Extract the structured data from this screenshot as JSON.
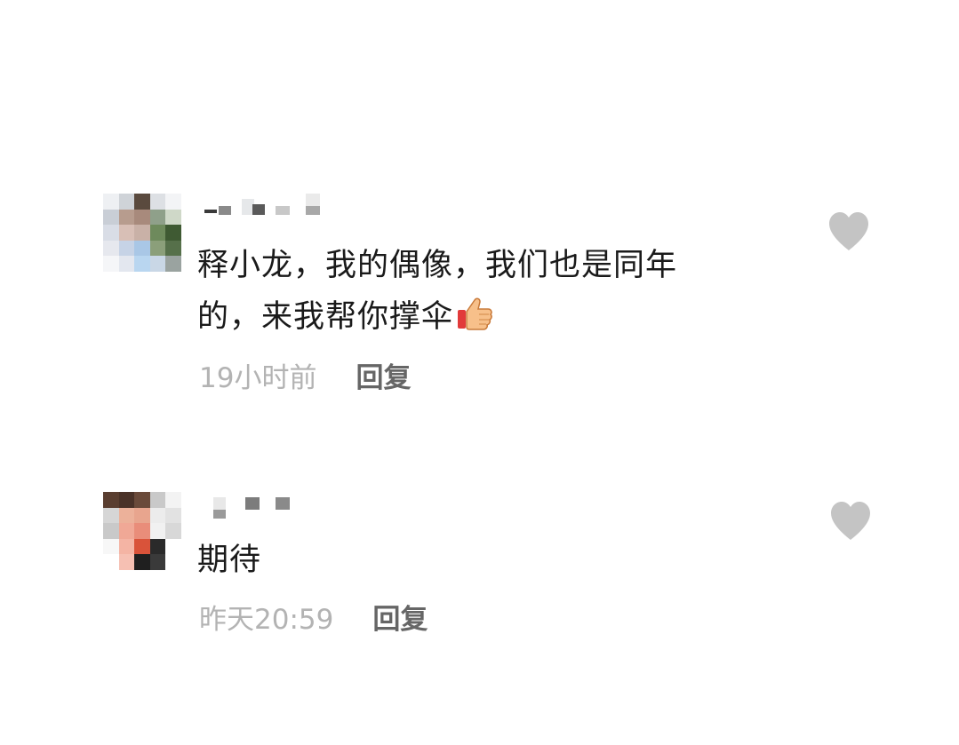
{
  "comments": [
    {
      "username": "",
      "text_line1": "释小龙，我的偶像，我们也是同年",
      "text_line2": "的，来我帮你撑伞",
      "emoji": "thumbs-up-icon",
      "time": "19小时前",
      "reply_label": "回复",
      "like_icon": "heart-icon"
    },
    {
      "username": "",
      "text_line1": "期待",
      "time": "昨天20:59",
      "reply_label": "回复",
      "like_icon": "heart-icon"
    }
  ],
  "colors": {
    "text": "#1a1a1a",
    "meta": "#b3b3b3",
    "reply": "#666666",
    "heart": "#c4c4c4"
  }
}
